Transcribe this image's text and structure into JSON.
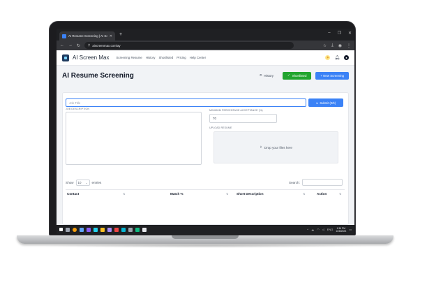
{
  "browser": {
    "tab_title": "AI Resume Screening | AI Scree...",
    "url": "aiscreenmax.com/ay",
    "new_tab": "+",
    "win_controls": [
      "–",
      "❐",
      "✕"
    ]
  },
  "nav": {
    "brand": "AI Screen Max",
    "links": [
      "Screening Resume",
      "History",
      "Shortlisted",
      "Pricing",
      "Help Center"
    ]
  },
  "page": {
    "title": "AI Resume Screening",
    "history_label": "History",
    "shortlisted_label": "Shortlisted",
    "new_screening_label": "+ New Screening"
  },
  "form": {
    "title_placeholder": "Job Title",
    "submit_label": "Submit (0/5)",
    "jd_label": "JOB DESCRIPTION",
    "threshold_label": "MINIMUM PERCENTAGE ACCEPTANCE (%)",
    "threshold_value": "70",
    "upload_label": "UPLOAD RESUME",
    "drop_text": "Drop your files here"
  },
  "table": {
    "show_label": "Show",
    "page_size": "10",
    "entries_label": "entries",
    "search_label": "Search:",
    "columns": [
      "Contact",
      "Match %",
      "Short Description",
      "Action"
    ]
  },
  "taskbar": {
    "tray_lang": "ENG",
    "time": "1:36 PM",
    "date": "11/8/2023"
  },
  "colors": {
    "primary": "#3b82f6",
    "success": "#22a52f",
    "title": "#111827"
  }
}
